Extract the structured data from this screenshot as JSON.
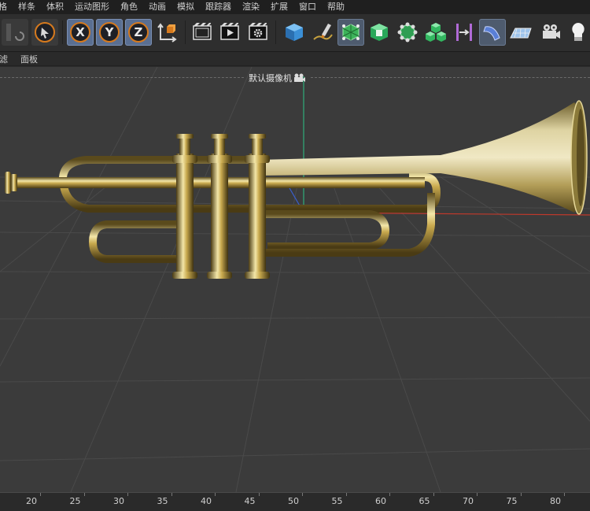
{
  "menu": [
    "格",
    "样条",
    "体积",
    "运动图形",
    "角色",
    "动画",
    "模拟",
    "跟踪器",
    "渲染",
    "扩展",
    "窗口",
    "帮助"
  ],
  "toolbar": {
    "axis_x": "X",
    "axis_y": "Y",
    "axis_z": "Z",
    "icons": [
      "undo-icon",
      "select-arrow-icon",
      "axis-x-button",
      "axis-y-button",
      "axis-z-button",
      "coordinate-system-icon",
      "render-view-icon",
      "render-picture-viewer-icon",
      "render-settings-icon",
      "cube-icon",
      "pen-spline-icon",
      "subdivision-icon",
      "extrude-icon",
      "mograph-cloner-icon",
      "voronoi-cubes-icon",
      "deformer-bend-icon",
      "sweep-icon",
      "floor-plane-icon",
      "camera-icon",
      "light-bulb-icon"
    ]
  },
  "subbar": [
    "滤",
    "面板"
  ],
  "viewport": {
    "camera_label": "默认摄像机",
    "axis_colors": {
      "x": "#c0392b",
      "y": "#2fae7a",
      "z": "#3a5fcd"
    },
    "object": "trumpet"
  },
  "timeline": {
    "ticks": [
      "20",
      "25",
      "30",
      "35",
      "40",
      "45",
      "50",
      "55",
      "60",
      "65",
      "70",
      "75",
      "80"
    ]
  }
}
